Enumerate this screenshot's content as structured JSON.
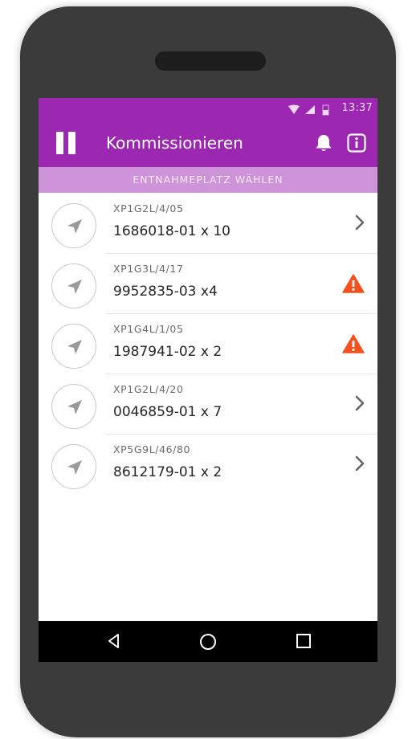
{
  "status_bar": {
    "time": "13:37"
  },
  "app_bar": {
    "title": "Kommissionieren",
    "icons": [
      "pause-icon",
      "bell-icon",
      "info-icon"
    ]
  },
  "subheader": {
    "label": "ENTNAHMEPLATZ WÄHLEN"
  },
  "items": [
    {
      "location": "XP1G2L/4/05",
      "article": "1686018-01 x 10",
      "action": "chevron-right-icon"
    },
    {
      "location": "XP1G3L/4/17",
      "article": "9952835-03 x4",
      "action": "warning-icon"
    },
    {
      "location": "XP1G4L/1/05",
      "article": "1987941-02 x 2",
      "action": "warning-icon"
    },
    {
      "location": "XP1G2L/4/20",
      "article": "0046859-01 x 7",
      "action": "chevron-right-icon"
    },
    {
      "location": "XP5G9L/46/80",
      "article": "8612179-01 x 2",
      "action": "chevron-right-icon"
    }
  ],
  "colors": {
    "primary": "#9c27b0",
    "subheader": "#ce93d8",
    "warning": "#f4511e",
    "device_frame": "#3b3b3b"
  }
}
